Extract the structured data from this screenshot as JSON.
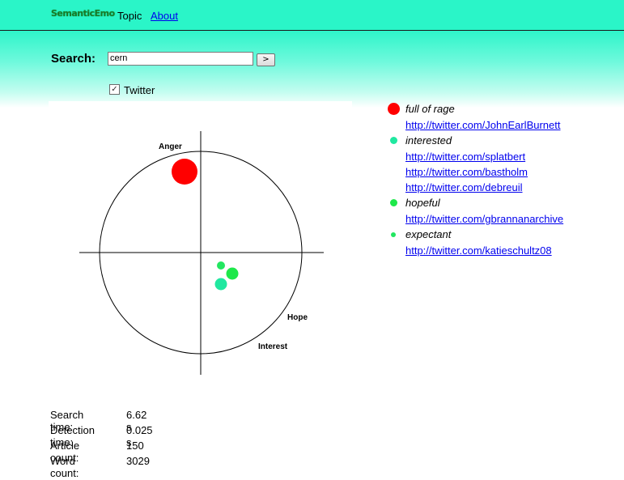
{
  "header": {
    "logo": "SemanticEmo",
    "nav": {
      "topic": "Topic",
      "about": "About"
    }
  },
  "search": {
    "label": "Search:",
    "value": "cern",
    "button": ">",
    "source_checkbox": {
      "label": "Twitter",
      "checked": true
    }
  },
  "plot": {
    "axis_labels": {
      "anger": "Anger",
      "hope": "Hope",
      "interest": "Interest"
    },
    "points": [
      {
        "emotion": "full of rage",
        "color": "#ff0000",
        "size": "large"
      },
      {
        "emotion": "interested",
        "color": "#20e8a0",
        "size": "medium"
      },
      {
        "emotion": "hopeful",
        "color": "#1ee84a",
        "size": "medium"
      },
      {
        "emotion": "expectant",
        "color": "#22e660",
        "size": "small"
      }
    ]
  },
  "legend": [
    {
      "label": "full of rage",
      "color": "#ff0000",
      "links": [
        "http://twitter.com/JohnEarlBurnett"
      ]
    },
    {
      "label": "interested",
      "color": "#20e8a0",
      "links": [
        "http://twitter.com/splatbert",
        "http://twitter.com/bastholm",
        "http://twitter.com/debreuil"
      ]
    },
    {
      "label": "hopeful",
      "color": "#1ee84a",
      "links": [
        "http://twitter.com/gbrannanarchive"
      ]
    },
    {
      "label": "expectant",
      "color": "#22e660",
      "links": [
        "http://twitter.com/katieschultz08"
      ]
    }
  ],
  "stats": [
    {
      "label": "Search time:",
      "value": "6.62 s"
    },
    {
      "label": "Detection time:",
      "value": "0.025 s"
    },
    {
      "label": "Article count:",
      "value": "150"
    },
    {
      "label": "Word count:",
      "value": "3029"
    }
  ]
}
